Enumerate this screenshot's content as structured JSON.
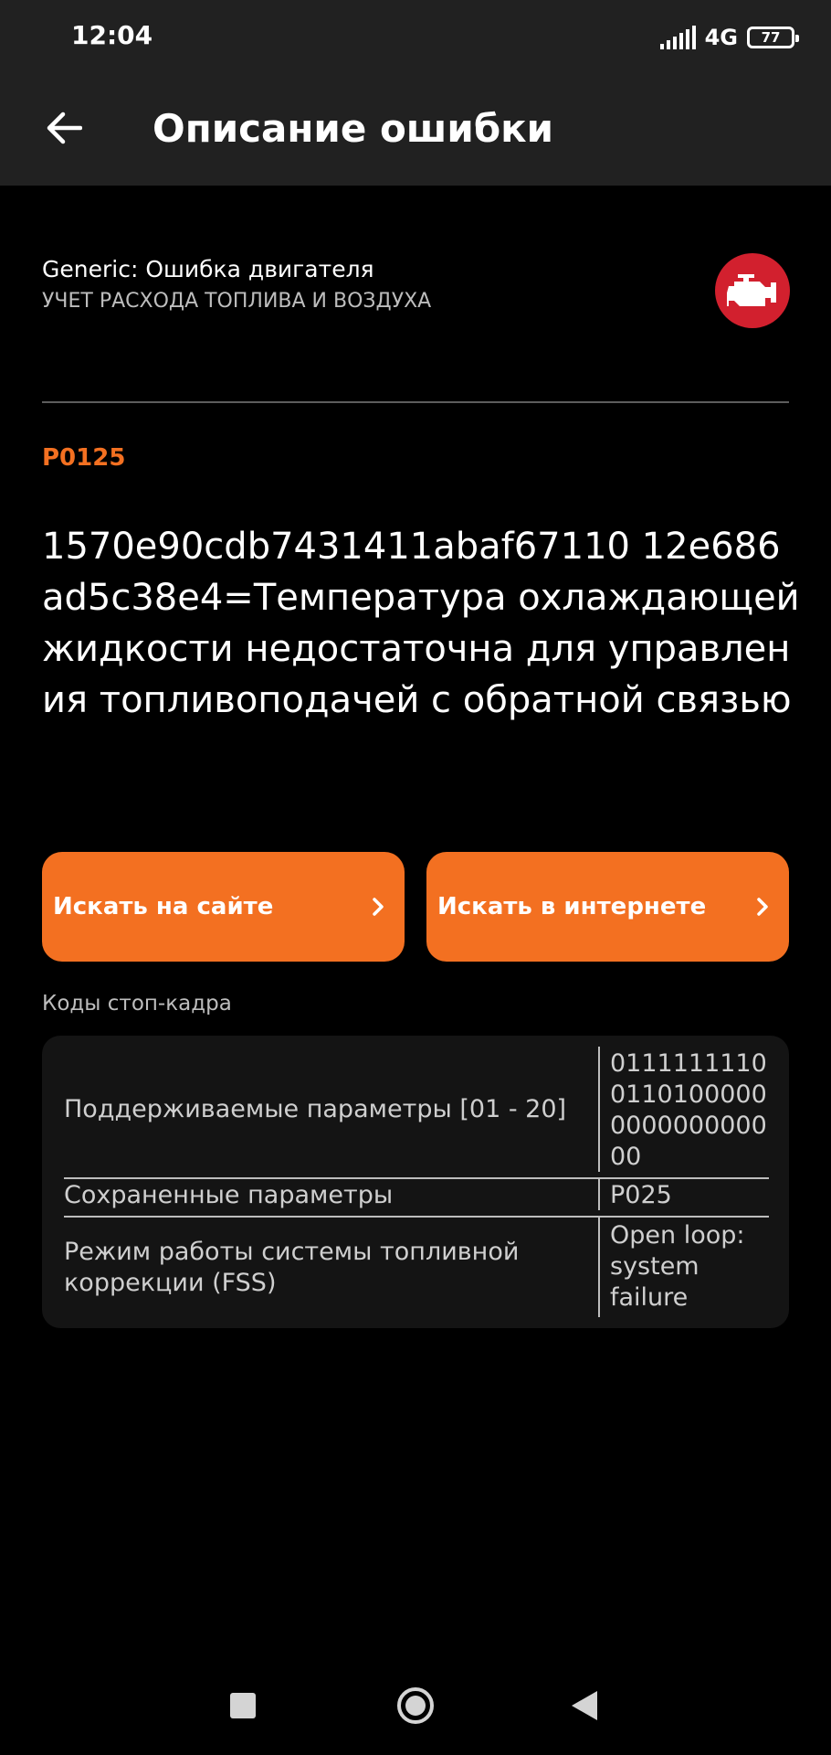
{
  "status_bar": {
    "time": "12:04",
    "network": "4G",
    "battery": "77",
    "icons": [
      "signal-icon",
      "battery-icon"
    ]
  },
  "app_bar": {
    "title": "Описание ошибки",
    "back_icon": "arrow-left-icon"
  },
  "header": {
    "category": "Generic: Ошибка двигателя",
    "subcategory": "УЧЕТ РАСХОДА ТОПЛИВА И ВОЗДУХА",
    "icon": "check-engine-icon",
    "icon_color": "#d2202e"
  },
  "error": {
    "code": "P0125",
    "code_color": "#f37021",
    "description": "1570e90cdb7431411abaf67110 12e686ad5c38e4=Температура охлаждающей жидкости недостаточна для управления топливоподачей с обратной связью"
  },
  "buttons": {
    "search_site": "Искать на сайте",
    "search_internet": "Искать в интернете",
    "accent_color": "#f37021"
  },
  "freeze_frame": {
    "label": "Коды стоп-кадра",
    "rows": [
      {
        "name": "Поддерживаемые параметры [01 - 20]",
        "value": "01111111100110100000000000000000"
      },
      {
        "name": "Сохраненные параметры",
        "value": "P025"
      },
      {
        "name": "Режим работы системы топливной коррекции (FSS)",
        "value": "Open loop: system failure"
      }
    ]
  },
  "nav_bar": {
    "icons": [
      "recents-square-icon",
      "home-circle-icon",
      "back-triangle-icon"
    ]
  }
}
